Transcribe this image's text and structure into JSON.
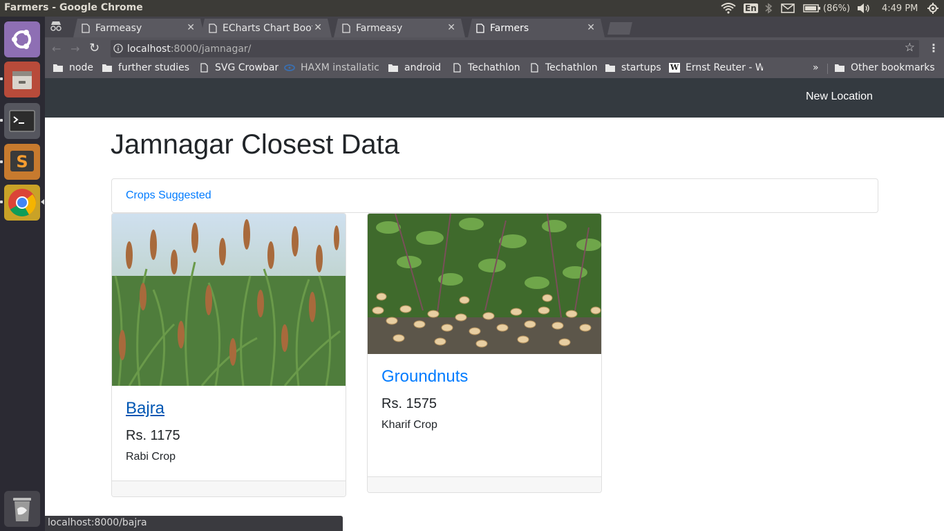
{
  "system": {
    "window_title": "Farmers - Google Chrome",
    "keyboard_layout": "En",
    "battery": "(86%)",
    "clock": "4:49 PM"
  },
  "launcher": {
    "items": [
      "ubuntu-dash-icon",
      "files-icon",
      "terminal-icon",
      "sublime-text-icon",
      "chrome-icon",
      "trash-icon"
    ]
  },
  "browser": {
    "tabs": [
      {
        "title": "Farmeasy"
      },
      {
        "title": "ECharts Chart Boot"
      },
      {
        "title": "Farmeasy"
      },
      {
        "title": "Farmers"
      }
    ],
    "url_host": "localhost",
    "url_path": ":8000/jamnagar/",
    "bookmarks": [
      {
        "label": "node",
        "icon": "folder-icon"
      },
      {
        "label": "further studies",
        "icon": "folder-icon"
      },
      {
        "label": "SVG Crowbar",
        "icon": "page-icon"
      },
      {
        "label": "HAXM installatic",
        "icon": "globe-icon"
      },
      {
        "label": "android",
        "icon": "folder-icon"
      },
      {
        "label": "Techathlon",
        "icon": "page-icon"
      },
      {
        "label": "Techathlon",
        "icon": "page-icon"
      },
      {
        "label": "startups",
        "icon": "folder-icon"
      },
      {
        "label": "Ernst Reuter - W",
        "icon": "wikipedia-icon"
      }
    ],
    "more_bookmarks": "»",
    "other_bookmarks": "Other bookmarks",
    "status_url": "localhost:8000/bajra"
  },
  "page": {
    "nav_link": "New Location",
    "heading": "Jamnagar Closest Data",
    "section_link": "Crops Suggested",
    "crops": [
      {
        "name": "Bajra",
        "price": "Rs. 1175",
        "season": "Rabi Crop"
      },
      {
        "name": "Groundnuts",
        "price": "Rs. 1575",
        "season": "Kharif Crop"
      }
    ]
  }
}
